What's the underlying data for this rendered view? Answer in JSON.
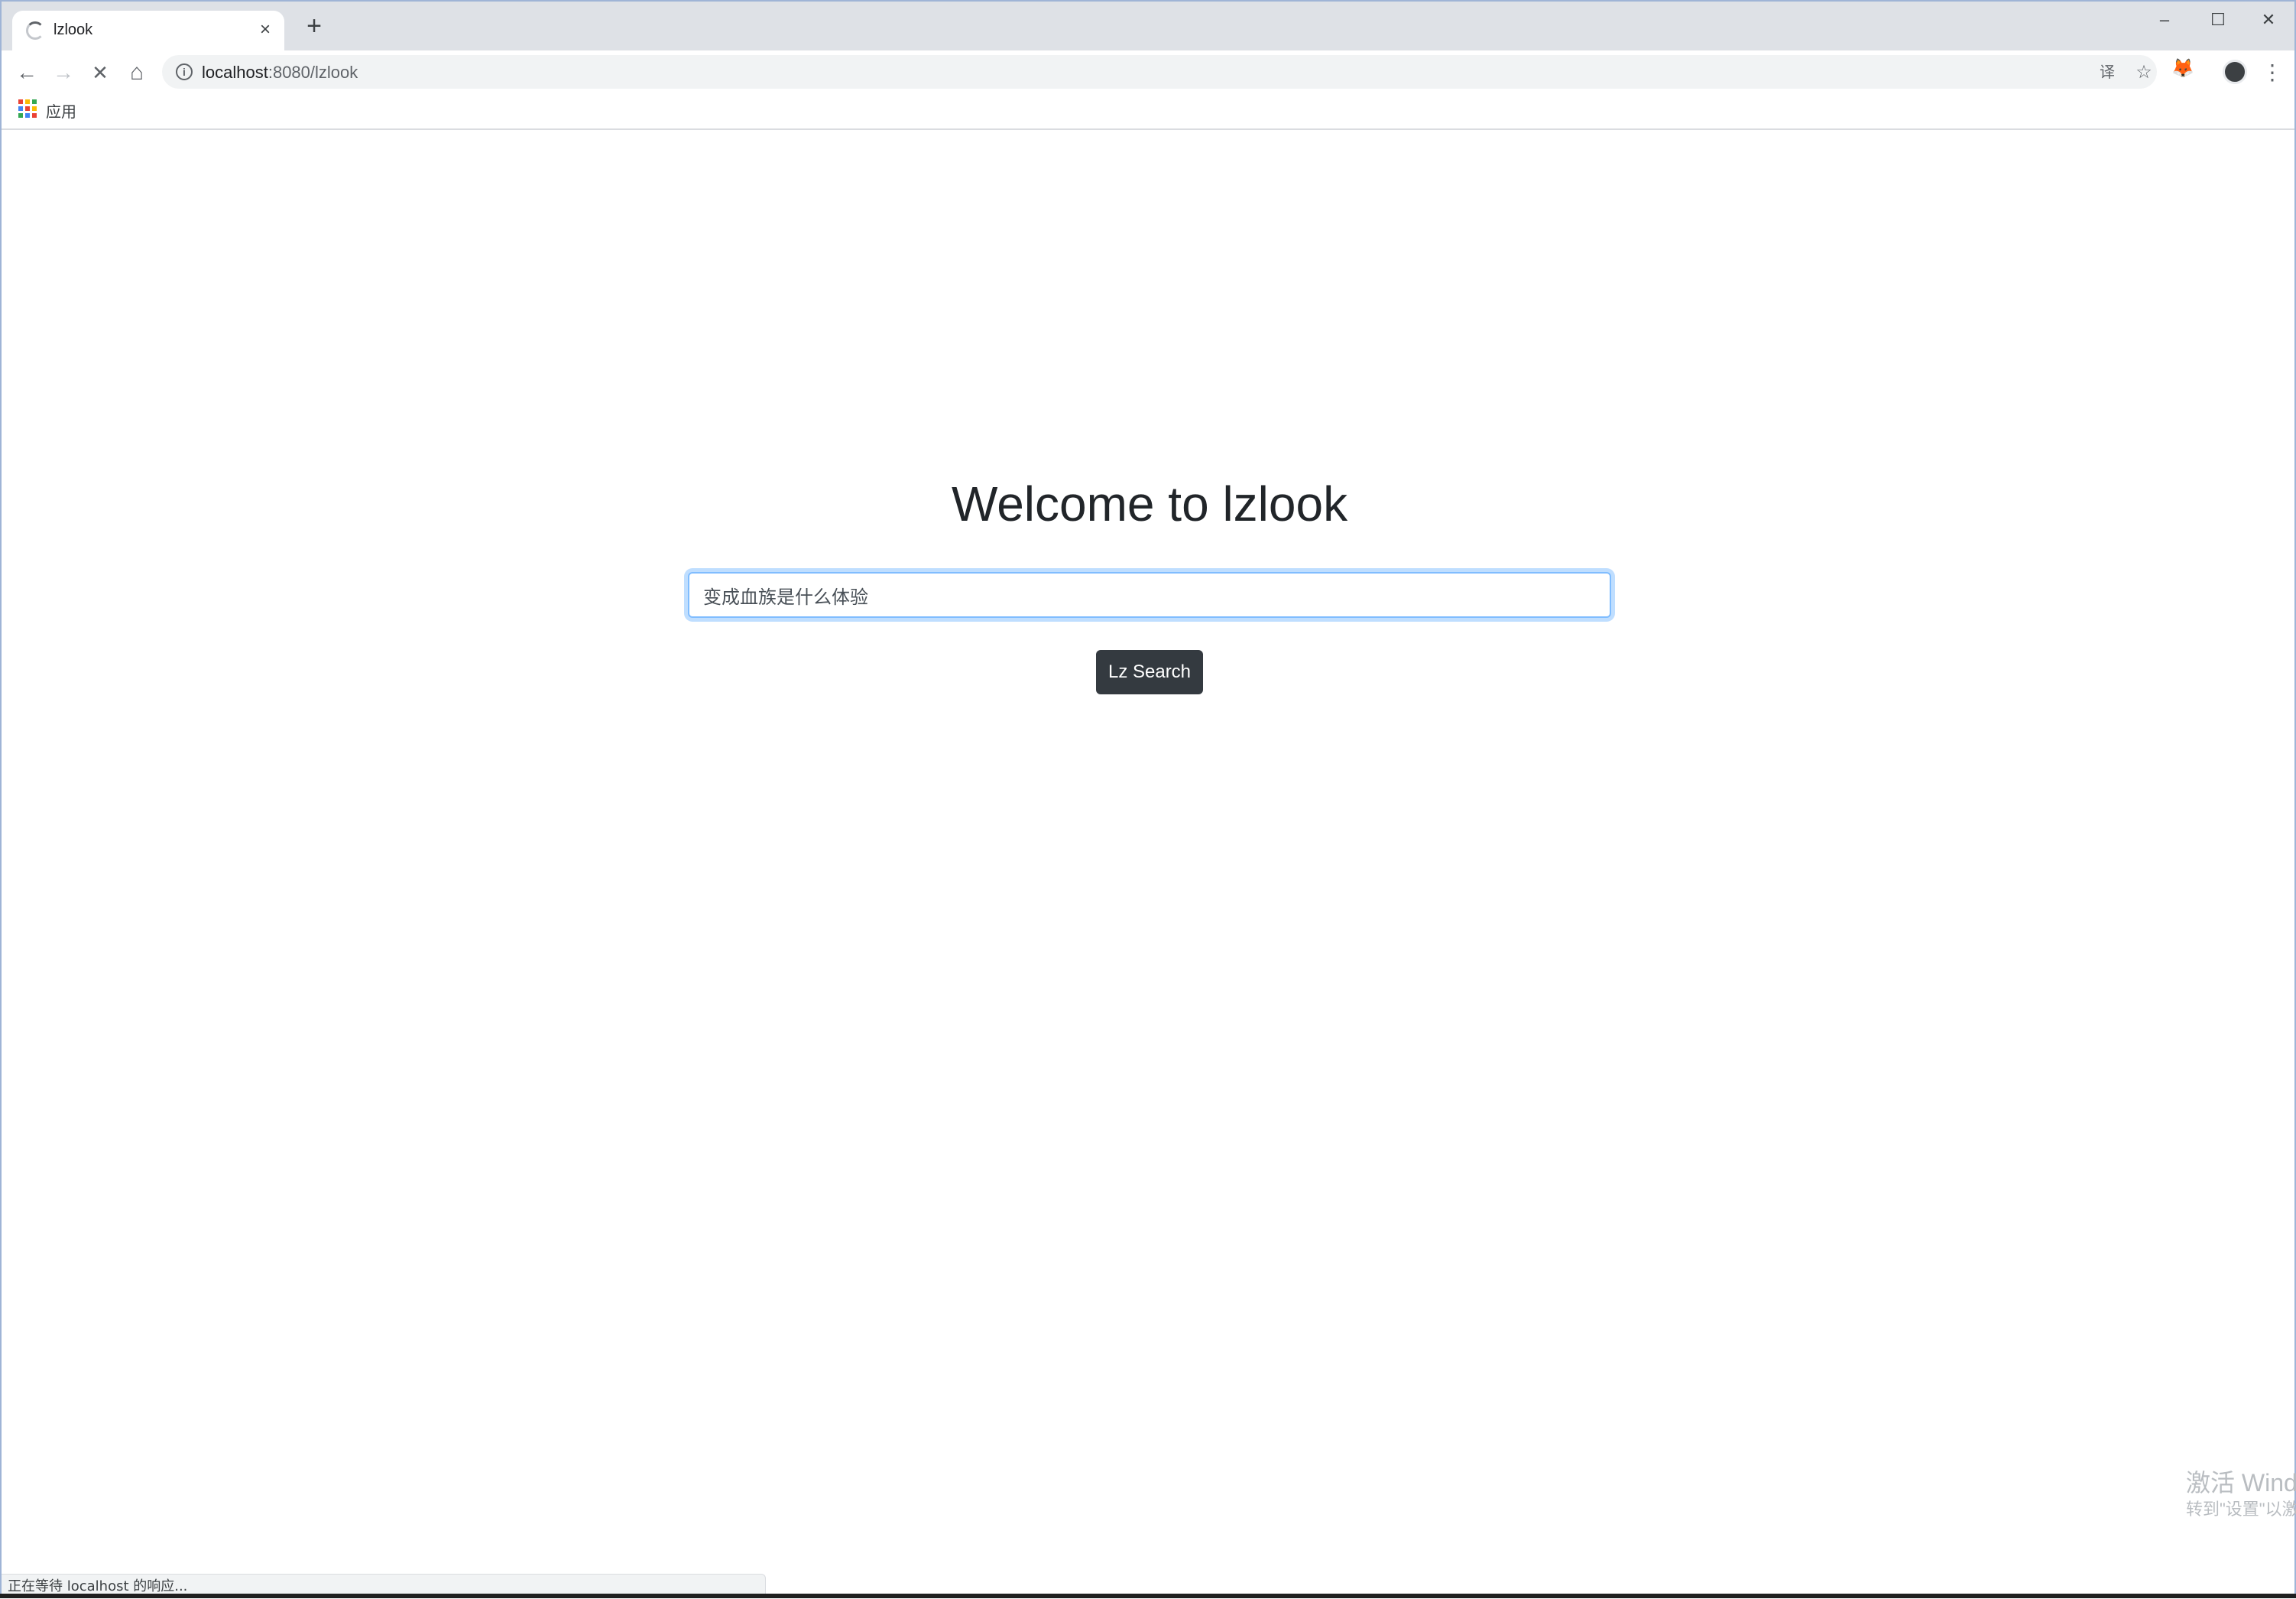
{
  "browser": {
    "tab": {
      "title": "lzlook",
      "close_glyph": "×"
    },
    "new_tab_glyph": "+",
    "window_controls": {
      "minimize": "–",
      "maximize": "☐",
      "close": "✕"
    },
    "nav": {
      "back": "←",
      "forward": "→",
      "stop": "✕",
      "home": "⌂"
    },
    "address": {
      "host": "localhost",
      "rest": ":8080/lzlook"
    },
    "omnibox_icons": {
      "translate": "译",
      "bookmark_star": "☆"
    },
    "extension_glyph": "🦊",
    "menu_glyph": "⋮",
    "bookmarks": {
      "apps_label": "应用"
    },
    "apps_colors": [
      "#ea4335",
      "#fbbc05",
      "#34a853",
      "#4285f4",
      "#ea4335",
      "#fbbc05",
      "#34a853",
      "#4285f4",
      "#ea4335"
    ]
  },
  "page": {
    "heading": "Welcome to lzlook",
    "search": {
      "value": "变成血族是什么体验",
      "button_label": "Lz Search"
    }
  },
  "status": {
    "text": "正在等待 localhost 的响应..."
  },
  "watermark": {
    "line1": "激活 Wind",
    "line2": "转到\"设置\"以激"
  }
}
